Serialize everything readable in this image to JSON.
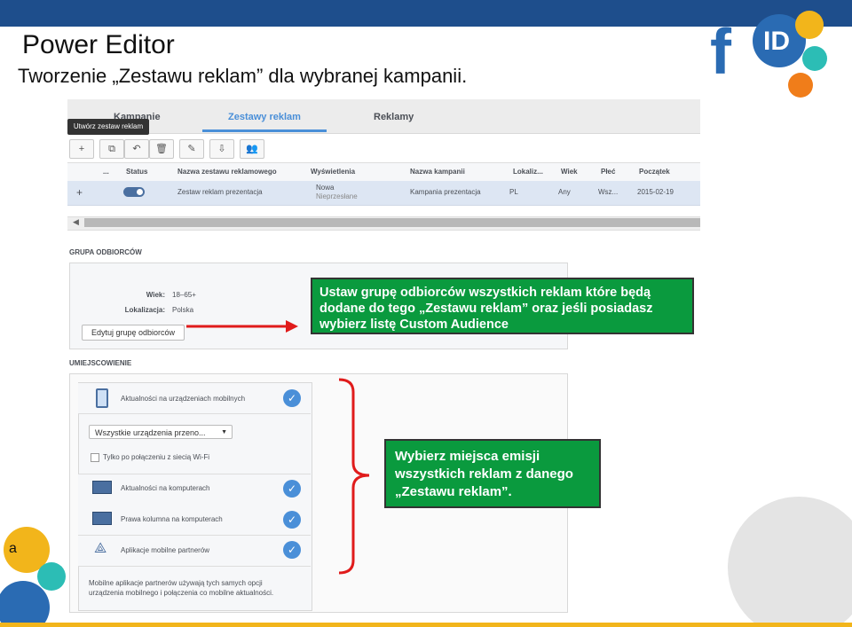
{
  "slide": {
    "title": "Power Editor",
    "subtitle": "Tworzenie „Zestawu reklam” dla wybranej kampanii.",
    "corner_letter": "a",
    "logo_text": "f",
    "logo_badge": "ID"
  },
  "tabs": {
    "campaigns": "Kampanie",
    "ad_sets": "Zestawy reklam",
    "ads": "Reklamy"
  },
  "toolbar": {
    "tooltip": "Utwórz zestaw reklam",
    "add": "+"
  },
  "table": {
    "headers": [
      "...",
      "Status",
      "Nazwa zestawu reklamowego",
      "Wyświetlenia",
      "Nazwa kampanii",
      "Lokaliz...",
      "Wiek",
      "Płeć",
      "Początek"
    ],
    "row": {
      "expand": "+",
      "name": "Zestaw reklam prezentacja",
      "impressions_status": "Nowa",
      "impressions_sub": "Nieprzesłane",
      "campaign": "Kampania prezentacja",
      "location": "PL",
      "age": "Any",
      "gender": "Wsz...",
      "start": "2015-02-19"
    }
  },
  "audience": {
    "section_title": "GRUPA ODBIORCÓW",
    "age_label": "Wiek:",
    "age_value": "18–65+",
    "location_label": "Lokalizacja:",
    "location_value": "Polska",
    "edit_button": "Edytuj grupę odbiorców"
  },
  "placement": {
    "section_title": "UMIEJSCOWIENIE",
    "mobile_feed": "Aktualności na urządzeniach mobilnych",
    "device_select": "Wszystkie urządzenia przeno...",
    "wifi_only": "Tylko po połączeniu z siecią Wi-Fi",
    "desktop_feed": "Aktualności na komputerach",
    "right_column": "Prawa kolumna na komputerach",
    "partner_apps": "Aplikacje mobilne partnerów",
    "note": "Mobilne aplikacje partnerów używają tych samych opcji urządzenia mobilnego i połączenia co mobilne aktualności."
  },
  "callouts": {
    "audience": "Ustaw grupę odbiorców wszystkich reklam które będą dodane do tego „Zestawu reklam” oraz jeśli posiadasz wybierz listę Custom Audience",
    "placement": "Wybierz miejsca emisji wszystkich reklam z danego „Zestawu reklam”."
  },
  "colors": {
    "topbar": "#1e4e8c",
    "callout_green": "#0a9a3e",
    "accent_blue": "#4a8fd8",
    "arrow_red": "#e01b1b"
  }
}
